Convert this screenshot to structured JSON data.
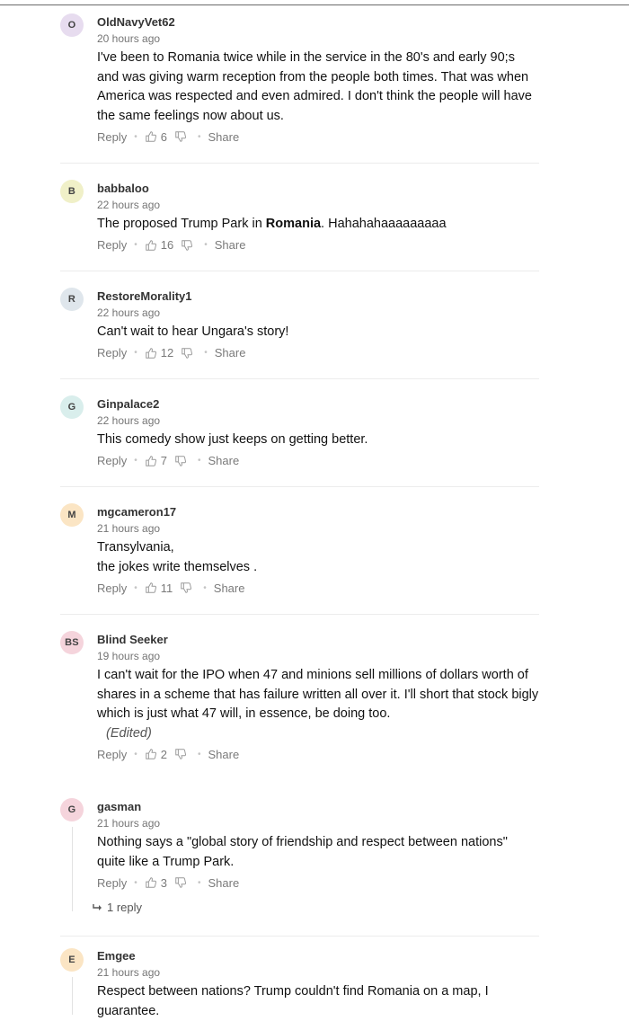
{
  "comments": [
    {
      "initials": "O",
      "avatar_color": "#e7dcef",
      "name": "OldNavyVet62",
      "time": "20 hours ago",
      "text": [
        "I've been to Romania twice while in the service in the 80's and early 90;s and was giving warm reception from the people both times. That was when America was respected and even admired. I don't think the people will have the same feelings now about us."
      ],
      "likes": "6",
      "reply_label": "Reply",
      "share_label": "Share"
    },
    {
      "initials": "B",
      "avatar_color": "#f0f0c8",
      "name": "babbaloo",
      "time": "22 hours ago",
      "text_before": "The proposed Trump Park in ",
      "text_bold": "Romania",
      "text_after": ". Hahahahaaaaaaaaa",
      "likes": "16",
      "reply_label": "Reply",
      "share_label": "Share"
    },
    {
      "initials": "R",
      "avatar_color": "#dfe6ec",
      "name": "RestoreMorality1",
      "time": "22 hours ago",
      "text": [
        "Can't wait to hear Ungara's story!"
      ],
      "likes": "12",
      "reply_label": "Reply",
      "share_label": "Share"
    },
    {
      "initials": "G",
      "avatar_color": "#d9eeec",
      "name": "Ginpalace2",
      "time": "22 hours ago",
      "text": [
        "This comedy show just keeps on getting better."
      ],
      "likes": "7",
      "reply_label": "Reply",
      "share_label": "Share"
    },
    {
      "initials": "M",
      "avatar_color": "#fbe5c4",
      "name": "mgcameron17",
      "time": "21 hours ago",
      "text": [
        "Transylvania,",
        "the jokes write themselves ."
      ],
      "likes": "11",
      "reply_label": "Reply",
      "share_label": "Share"
    },
    {
      "initials": "BS",
      "avatar_color": "#f5d4dc",
      "name": "Blind Seeker",
      "time": "19 hours ago",
      "text": [
        "I can't wait for the IPO when 47 and minions sell millions of dollars worth of shares in a scheme that has failure written all over it. I'll short that stock bigly which is just what 47 will, in essence, be doing too."
      ],
      "edited": "(Edited)",
      "likes": "2",
      "reply_label": "Reply",
      "share_label": "Share"
    },
    {
      "initials": "G",
      "avatar_color": "#f5d4dc",
      "name": "gasman",
      "time": "21 hours ago",
      "text": [
        "Nothing says a \"global story of friendship and respect between nations\" quite like a Trump Park."
      ],
      "likes": "3",
      "reply_label": "Reply",
      "share_label": "Share",
      "replies": "1 reply"
    },
    {
      "initials": "E",
      "avatar_color": "#fbe5c4",
      "name": "Emgee",
      "time": "21 hours ago",
      "text": [
        "Respect between nations? Trump couldn't find Romania on a map, I guarantee."
      ]
    }
  ]
}
